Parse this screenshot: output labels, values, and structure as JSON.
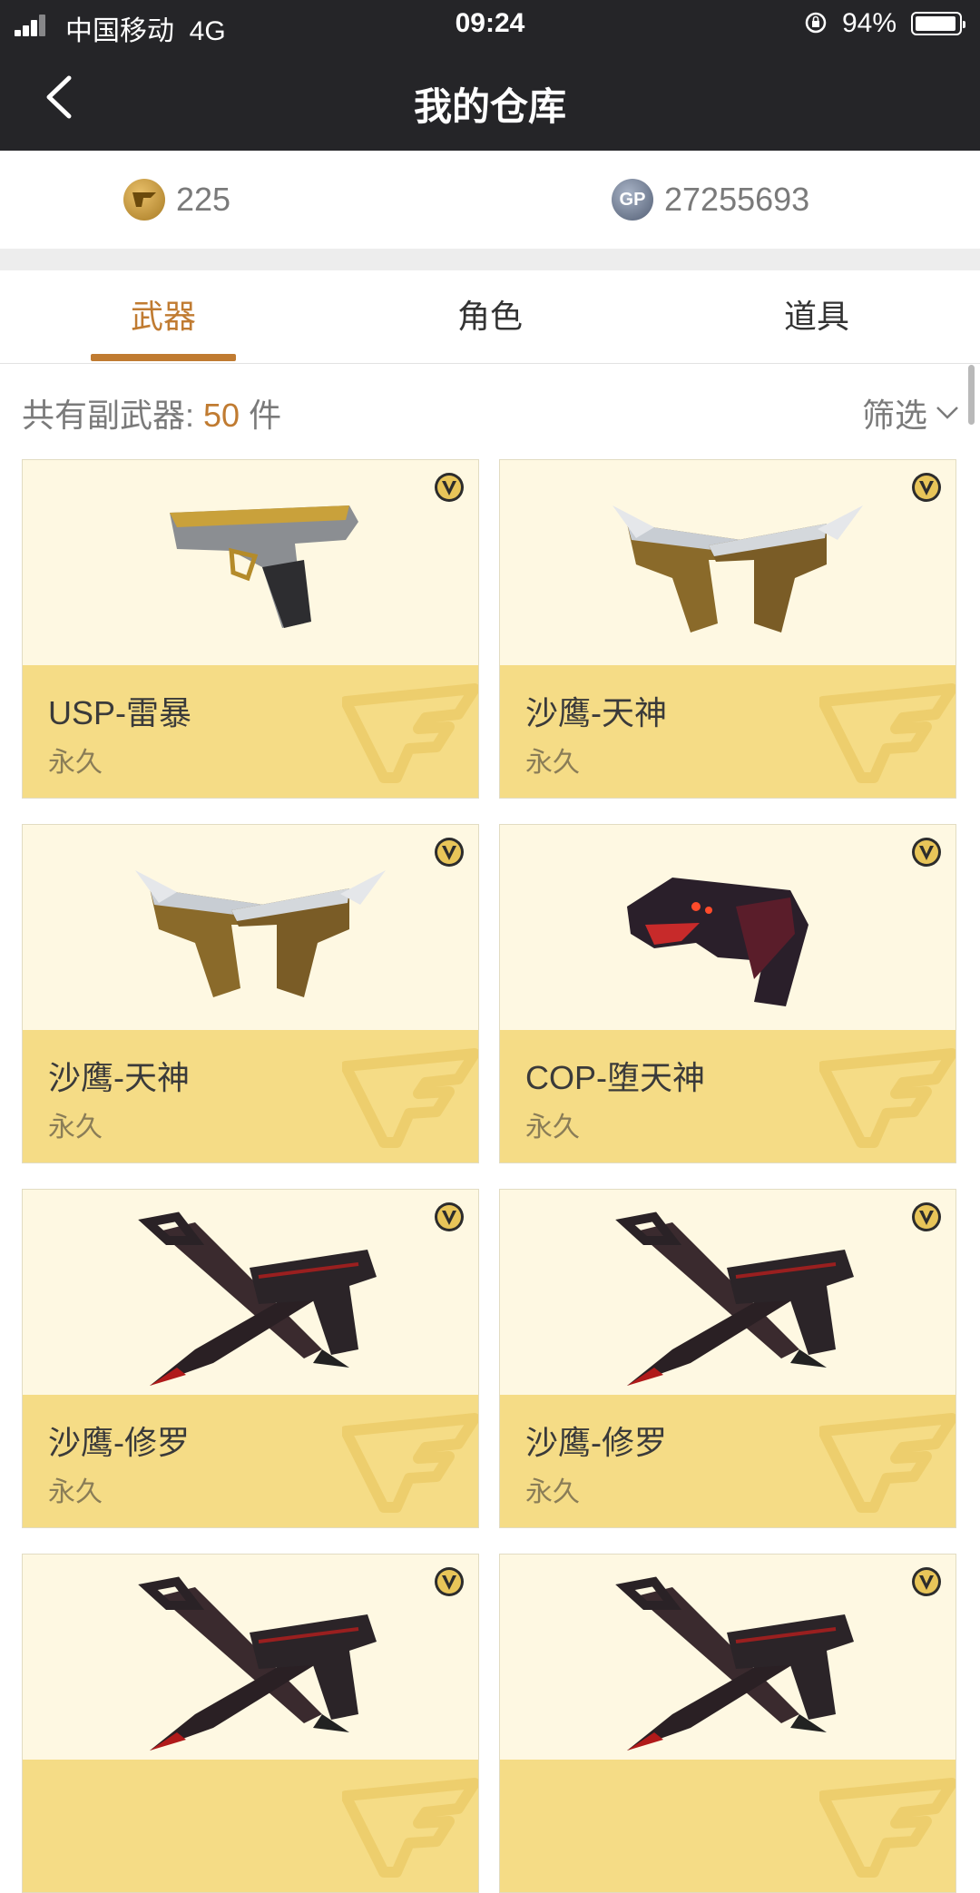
{
  "status": {
    "carrier": "中国移动",
    "network": "4G",
    "time": "09:24",
    "battery": "94%"
  },
  "nav": {
    "title": "我的仓库"
  },
  "currency": {
    "cf": "225",
    "gp": "27255693",
    "gp_badge": "GP"
  },
  "tabs": [
    "武器",
    "角色",
    "道具"
  ],
  "summary": {
    "prefix": "共有副武器: ",
    "count": "50",
    "suffix": " 件",
    "filter_label": "筛选"
  },
  "items": [
    {
      "name": "USP-雷暴",
      "duration": "永久",
      "style": "usp"
    },
    {
      "name": "沙鹰-天神",
      "duration": "永久",
      "style": "gold"
    },
    {
      "name": "沙鹰-天神",
      "duration": "永久",
      "style": "gold"
    },
    {
      "name": "COP-堕天神",
      "duration": "永久",
      "style": "cop"
    },
    {
      "name": "沙鹰-修罗",
      "duration": "永久",
      "style": "dark"
    },
    {
      "name": "沙鹰-修罗",
      "duration": "永久",
      "style": "dark"
    },
    {
      "name": "",
      "duration": "",
      "style": "dark"
    },
    {
      "name": "",
      "duration": "",
      "style": "dark"
    }
  ],
  "colors": {
    "accent": "#c07b31",
    "card_top": "#fef8e2",
    "card_bottom": "#f5dc86",
    "nav_bg": "#252528"
  }
}
